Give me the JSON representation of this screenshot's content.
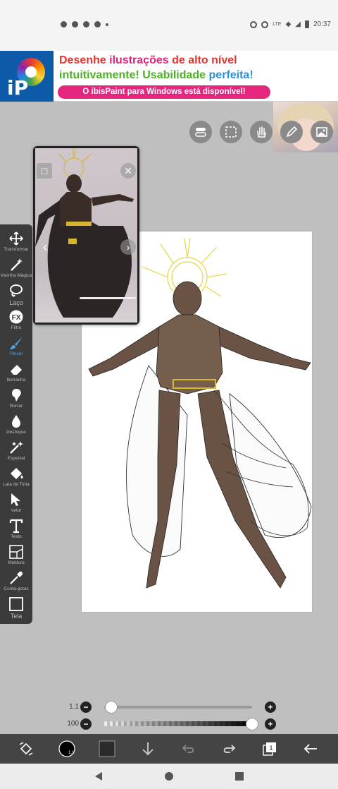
{
  "status_bar": {
    "time": "20:37",
    "network": "LTE"
  },
  "ad": {
    "line1_word1": "Desenhe",
    "line1_word2": "ilustrações",
    "line1_word3": "de alto nível",
    "line2_word1": "intuitivamente!",
    "line2_word2": "Usabilidade",
    "line2_word3": "perfeita!",
    "button": "O ibisPaint para Windows está disponível!",
    "logo": "iP"
  },
  "top_toolbar": [
    "toggle-icon",
    "selection-icon",
    "hand-icon",
    "pen-icon",
    "image-icon"
  ],
  "tools": [
    {
      "label": "Transformar",
      "icon": "move-icon"
    },
    {
      "label": "Varinha Mágica",
      "icon": "magic-wand-icon"
    },
    {
      "label": "Laço",
      "icon": "lasso-icon"
    },
    {
      "label": "Filtro",
      "icon": "fx-icon"
    },
    {
      "label": "Pincel",
      "icon": "brush-icon"
    },
    {
      "label": "Borracha",
      "icon": "eraser-icon"
    },
    {
      "label": "Borrar",
      "icon": "smudge-icon"
    },
    {
      "label": "Desfoque",
      "icon": "blur-icon"
    },
    {
      "label": "Especial",
      "icon": "special-icon"
    },
    {
      "label": "Lata de Tinta",
      "icon": "bucket-icon"
    },
    {
      "label": "Vetor",
      "icon": "vector-icon"
    },
    {
      "label": "Texto",
      "icon": "text-icon"
    },
    {
      "label": "Moldura",
      "icon": "frame-icon"
    },
    {
      "label": "Conta-gotas",
      "icon": "eyedropper-icon"
    },
    {
      "label": "Tela",
      "icon": "canvas-icon"
    }
  ],
  "brush_size": {
    "value": "1.1",
    "fraction": 0.03
  },
  "opacity": {
    "value": "100",
    "fraction": 1.0
  },
  "brush_color": "#2b2b2b",
  "layer_count": "1",
  "accent": "#4da3e8"
}
